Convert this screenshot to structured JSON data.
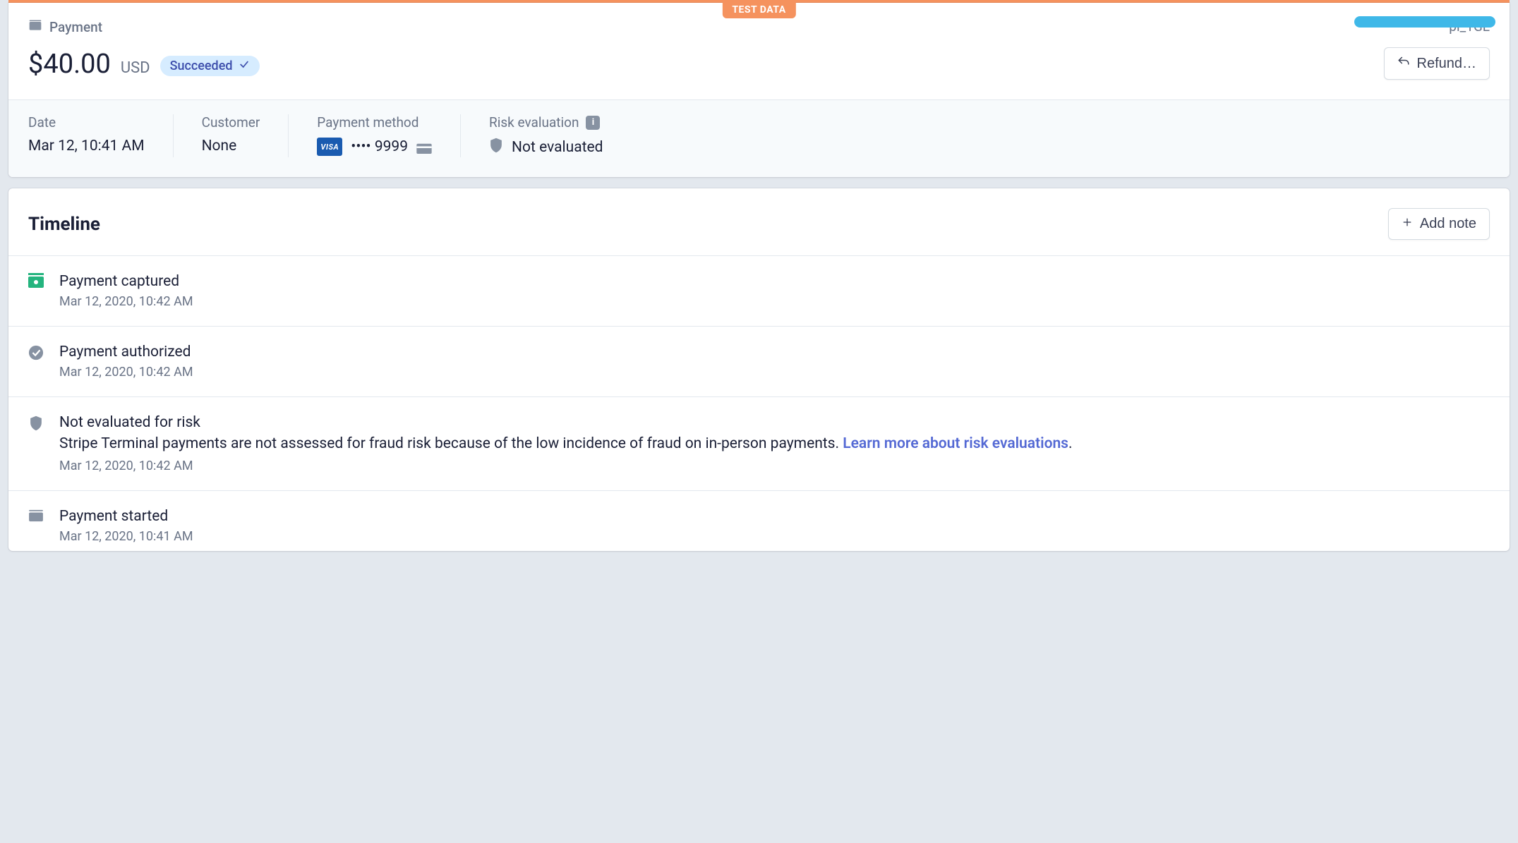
{
  "testBadge": "TEST DATA",
  "header": {
    "crumb": "Payment",
    "amount": "$40.00",
    "currency": "USD",
    "status": "Succeeded",
    "paymentId": "pi_1GL",
    "refundButton": "Refund…"
  },
  "summary": {
    "dateLabel": "Date",
    "dateValue": "Mar 12, 10:41 AM",
    "customerLabel": "Customer",
    "customerValue": "None",
    "methodLabel": "Payment method",
    "cardBrand": "VISA",
    "last4": "•••• 9999",
    "riskLabel": "Risk evaluation",
    "riskValue": "Not evaluated"
  },
  "timeline": {
    "title": "Timeline",
    "addNote": "Add note",
    "items": [
      {
        "title": "Payment captured",
        "ts": "Mar 12, 2020, 10:42 AM"
      },
      {
        "title": "Payment authorized",
        "ts": "Mar 12, 2020, 10:42 AM"
      },
      {
        "title": "Not evaluated for risk",
        "desc": "Stripe Terminal payments are not assessed for fraud risk because of the low incidence of fraud on in-person payments. ",
        "link": "Learn more about risk evaluations",
        "descAfter": ".",
        "ts": "Mar 12, 2020, 10:42 AM"
      },
      {
        "title": "Payment started",
        "ts": "Mar 12, 2020, 10:41 AM"
      }
    ]
  }
}
